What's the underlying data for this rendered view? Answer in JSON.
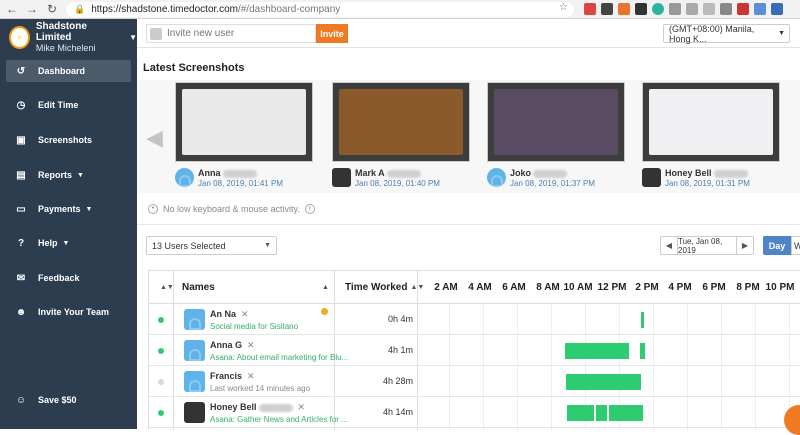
{
  "browser": {
    "url_host": "https://shadstone.timedoctor.com",
    "url_path": "/#/dashboard-company"
  },
  "sidebar": {
    "company_name": "Shadstone Limited",
    "user_name": "Mike Micheleni",
    "items": [
      {
        "label": "Dashboard",
        "icon": "dashboard-icon"
      },
      {
        "label": "Edit Time",
        "icon": "clock-icon"
      },
      {
        "label": "Screenshots",
        "icon": "screenshot-icon"
      },
      {
        "label": "Reports",
        "icon": "report-icon"
      },
      {
        "label": "Payments",
        "icon": "card-icon"
      },
      {
        "label": "Help",
        "icon": "help-icon"
      },
      {
        "label": "Feedback",
        "icon": "megaphone-icon"
      },
      {
        "label": "Invite Your Team",
        "icon": "add-user-icon"
      },
      {
        "label": "Save $50",
        "icon": "user-icon"
      }
    ]
  },
  "topbar": {
    "invite_placeholder": "Invite new user",
    "invite_button": "Invite",
    "timezone": "(GMT+08:00) Manila, Hong K..."
  },
  "screenshots": {
    "title": "Latest Screenshots",
    "items": [
      {
        "name": "Anna",
        "time": "Jan 08, 2019, 01:41 PM"
      },
      {
        "name": "Mark A",
        "time": "Jan 08, 2019, 01:40 PM"
      },
      {
        "name": "Joko",
        "time": "Jan 08, 2019, 01:37 PM"
      },
      {
        "name": "Honey Bell",
        "time": "Jan 08, 2019, 01:31 PM"
      }
    ],
    "no_activity": "No low keyboard & mouse activity."
  },
  "filters": {
    "users_selected": "13 Users Selected",
    "date": "Tue, Jan 08, 2019",
    "day": "Day",
    "week": "W"
  },
  "table": {
    "col_names": "Names",
    "col_time": "Time Worked",
    "hours": [
      "2 AM",
      "4 AM",
      "6 AM",
      "8 AM",
      "10 AM",
      "12 PM",
      "2 PM",
      "4 PM",
      "6 PM",
      "8 PM",
      "10 PM"
    ],
    "rows": [
      {
        "name": "An Na",
        "sub": "Social media for Sisitano",
        "worked": "0h 4m",
        "status": "online"
      },
      {
        "name": "Anna G",
        "sub": "Asana: About email marketing for Blu...",
        "worked": "4h 1m",
        "status": "online"
      },
      {
        "name": "Francis",
        "sub": "Last worked 14 minutes ago",
        "worked": "4h 28m",
        "status": "offline"
      },
      {
        "name": "Honey Bell",
        "sub": "Asana: Gather News and Articles for ...",
        "worked": "4h 14m",
        "status": "online"
      }
    ]
  },
  "colors": {
    "sidebar": "#2c3d50",
    "accent": "#f07a23",
    "green": "#2ecc71",
    "blue": "#4f84c9"
  }
}
